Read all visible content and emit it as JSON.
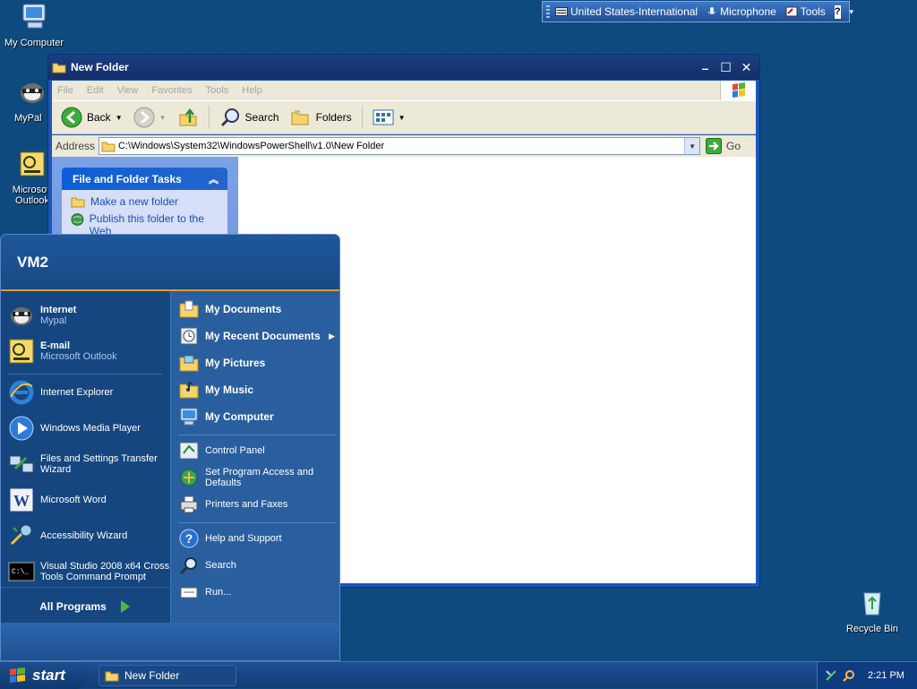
{
  "desktop": {
    "icons": [
      {
        "label": "My Computer"
      },
      {
        "label": "MyPal"
      },
      {
        "label": "Microsoft Outlook"
      },
      {
        "label": "Recycle Bin"
      }
    ]
  },
  "langbar": {
    "language": "United States-International",
    "microphone": "Microphone",
    "tools": "Tools",
    "help": "?"
  },
  "window": {
    "title": "New Folder",
    "menu": [
      "File",
      "Edit",
      "View",
      "Favorites",
      "Tools",
      "Help"
    ],
    "toolbar": {
      "back": "Back",
      "search": "Search",
      "folders": "Folders"
    },
    "address": {
      "label": "Address",
      "value": "C:\\Windows\\System32\\WindowsPowerShell\\v1.0\\New Folder",
      "go": "Go"
    },
    "tasks": {
      "heading": "File and Folder Tasks",
      "items": [
        "Make a new folder",
        "Publish this folder to the Web"
      ]
    }
  },
  "startmenu": {
    "user": "VM2",
    "pinned": [
      {
        "title": "Internet",
        "sub": "Mypal"
      },
      {
        "title": "E-mail",
        "sub": "Microsoft Outlook"
      }
    ],
    "recent": [
      "Internet Explorer",
      "Windows Media Player",
      "Files and Settings Transfer Wizard",
      "Microsoft Word",
      "Accessibility Wizard",
      "Visual Studio 2008 x64 Cross Tools Command Prompt"
    ],
    "all_programs": "All Programs",
    "right": {
      "places": [
        "My Documents",
        "My Recent Documents",
        "My Pictures",
        "My Music",
        "My Computer"
      ],
      "settings": [
        "Control Panel",
        "Set Program Access and Defaults",
        "Printers and Faxes"
      ],
      "support": [
        "Help and Support",
        "Search",
        "Run..."
      ]
    }
  },
  "taskbar": {
    "start": "start",
    "task": "New Folder",
    "clock": "2:21 PM"
  }
}
